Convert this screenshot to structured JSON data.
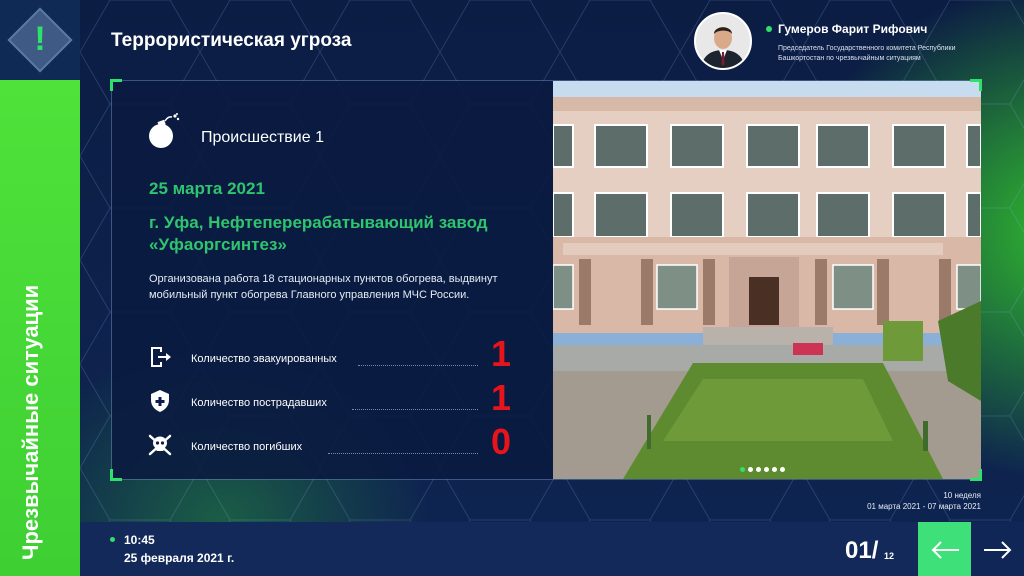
{
  "sidebar": {
    "label": "Чрезвычайные ситуации",
    "logo_icon": "alert-diamond-icon"
  },
  "header": {
    "title": "Террористическая угроза",
    "person_name": "Гумеров Фарит Рифович",
    "person_role": "Председатель Государственного комитета Республики Башкортостан по чрезвычайным ситуациям"
  },
  "incident": {
    "title": "Происшествие 1",
    "date": "25 марта 2021",
    "place": "г. Уфа, Нефтеперерабатывающий завод «Уфаоргсинтез»",
    "description": "Организована работа 18 стационарных пунктов обогрева, выдвинут мобильный пункт обогрева Главного управления МЧС России.",
    "stats": [
      {
        "label": "Количество эвакуированных",
        "value": "1",
        "icon": "exit-door-icon"
      },
      {
        "label": "Количество пострадавших",
        "value": "1",
        "icon": "shield-cross-icon"
      },
      {
        "label": "Количество погибших",
        "value": "0",
        "icon": "skull-icon"
      }
    ]
  },
  "carousel": {
    "total_dots": 6,
    "active_index": 0
  },
  "week": {
    "label": "10 неделя",
    "range": "01 марта 2021 - 07 марта 2021"
  },
  "footer": {
    "time": "10:45",
    "date": "25 февраля 2021 г.",
    "page": "01/",
    "total": "12",
    "prev_icon": "arrow-left-icon",
    "next_icon": "arrow-right-icon"
  },
  "colors": {
    "accent_green": "#2fe06a",
    "date_green": "#2fc46e",
    "stat_red": "#e8141c",
    "navy": "#0c1f44"
  }
}
